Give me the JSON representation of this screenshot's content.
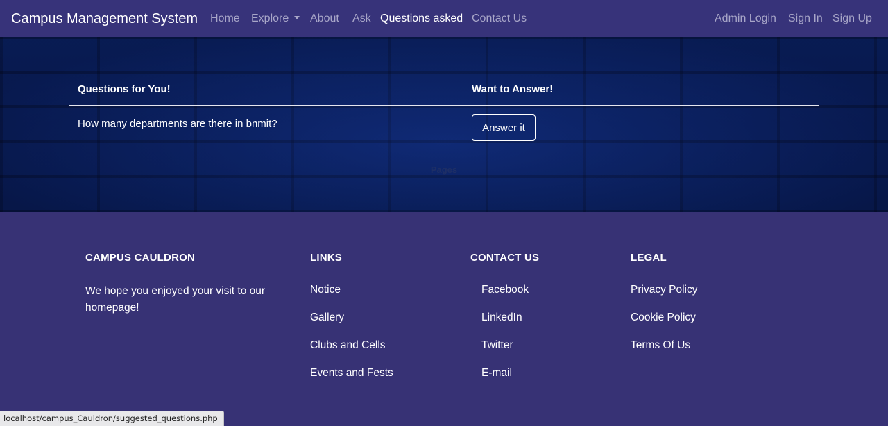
{
  "navbar": {
    "brand": "Campus Management System",
    "links": {
      "home": "Home",
      "explore": "Explore",
      "about": "About",
      "ask": "Ask",
      "questions_asked": "Questions asked",
      "contact": "Contact Us",
      "admin_login": "Admin Login",
      "sign_in": "Sign In",
      "sign_up": "Sign Up"
    }
  },
  "questions": {
    "col_question": "Questions for You!",
    "col_answer": "Want to Answer!",
    "rows": [
      {
        "question": "How many departments are there in bnmit?",
        "button": "Answer it"
      }
    ],
    "pages_label": "Pages"
  },
  "footer": {
    "about": {
      "heading": "CAMPUS CAULDRON",
      "text": "We hope you enjoyed your visit to our homepage!"
    },
    "links": {
      "heading": "LINKS",
      "items": [
        "Notice",
        "Gallery",
        "Clubs and Cells",
        "Events and Fests"
      ]
    },
    "contact": {
      "heading": "CONTACT US",
      "items": [
        "Facebook",
        "LinkedIn",
        "Twitter",
        "E-mail"
      ]
    },
    "legal": {
      "heading": "LEGAL",
      "items": [
        "Privacy Policy",
        "Cookie Policy",
        "Terms Of Us"
      ]
    }
  },
  "status_bar": {
    "url": "localhost/campus_Cauldron/suggested_questions.php"
  },
  "colors": {
    "navbar_bg": "#37337a",
    "footer_bg": "#373275",
    "hero_bg": "#0c2870",
    "active_link": "#ffffff",
    "inactive_link": "#a8a6c8"
  }
}
